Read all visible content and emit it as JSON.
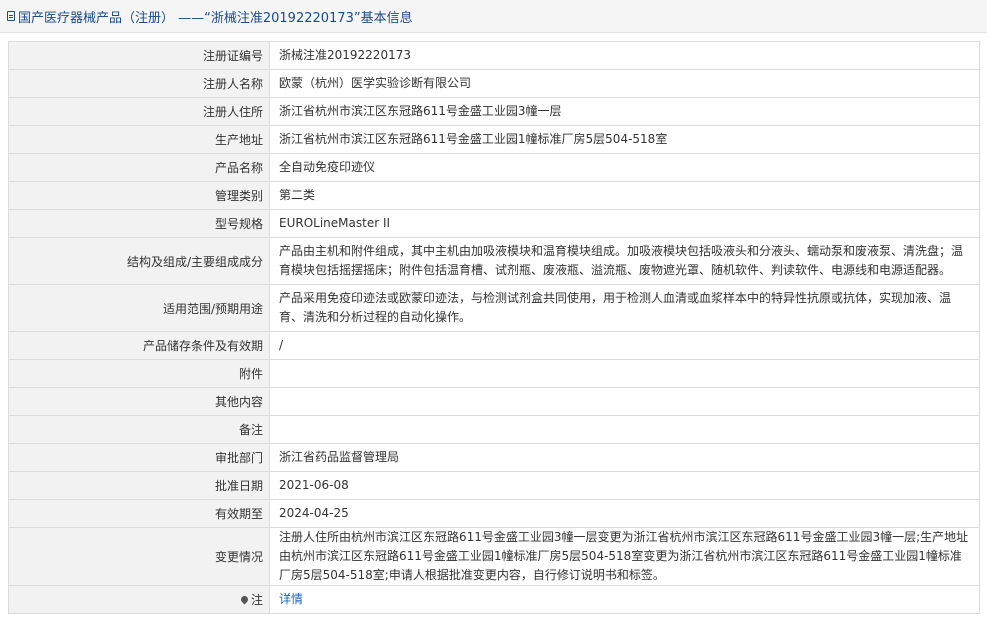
{
  "header": {
    "icon": "document-icon",
    "title": "国产医疗器械产品（注册） ——“浙械注准20192220173”基本信息"
  },
  "rows": [
    {
      "label": "注册证编号",
      "value": "浙械注准20192220173"
    },
    {
      "label": "注册人名称",
      "value": "欧蒙（杭州）医学实验诊断有限公司"
    },
    {
      "label": "注册人住所",
      "value": "浙江省杭州市滨江区东冠路611号金盛工业园3幢一层"
    },
    {
      "label": "生产地址",
      "value": "浙江省杭州市滨江区东冠路611号金盛工业园1幢标准厂房5层504-518室"
    },
    {
      "label": "产品名称",
      "value": "全自动免疫印迹仪"
    },
    {
      "label": "管理类别",
      "value": "第二类"
    },
    {
      "label": "型号规格",
      "value": "EUROLineMaster II"
    },
    {
      "label": "结构及组成/主要组成成分",
      "value": "产品由主机和附件组成，其中主机由加吸液模块和温育模块组成。加吸液模块包括吸液头和分液头、蠕动泵和废液泵、清洗盘；温育模块包括摇摆摇床；附件包括温育槽、试剂瓶、废液瓶、溢流瓶、废物遮光罩、随机软件、判读软件、电源线和电源适配器。"
    },
    {
      "label": "适用范围/预期用途",
      "value": "产品采用免疫印迹法或欧蒙印迹法，与检测试剂盒共同使用，用于检测人血清或血浆样本中的特异性抗原或抗体，实现加液、温育、清洗和分析过程的自动化操作。"
    },
    {
      "label": "产品储存条件及有效期",
      "value": "/"
    },
    {
      "label": "附件",
      "value": ""
    },
    {
      "label": "其他内容",
      "value": ""
    },
    {
      "label": "备注",
      "value": ""
    },
    {
      "label": "审批部门",
      "value": "浙江省药品监督管理局"
    },
    {
      "label": "批准日期",
      "value": "2021-06-08"
    },
    {
      "label": "有效期至",
      "value": "2024-04-25"
    },
    {
      "label": "变更情况",
      "value": "注册人住所由杭州市滨江区东冠路611号金盛工业园3幢一层变更为浙江省杭州市滨江区东冠路611号金盛工业园3幢一层;生产地址由杭州市滨江区东冠路611号金盛工业园1幢标准厂房5层504-518室变更为浙江省杭州市滨江区东冠路611号金盛工业园1幢标准厂房5层504-518室;申请人根据批准变更内容，自行修订说明书和标签。"
    }
  ],
  "note": {
    "icon": "map-pin-icon",
    "label": "注",
    "link_text": "详情"
  }
}
